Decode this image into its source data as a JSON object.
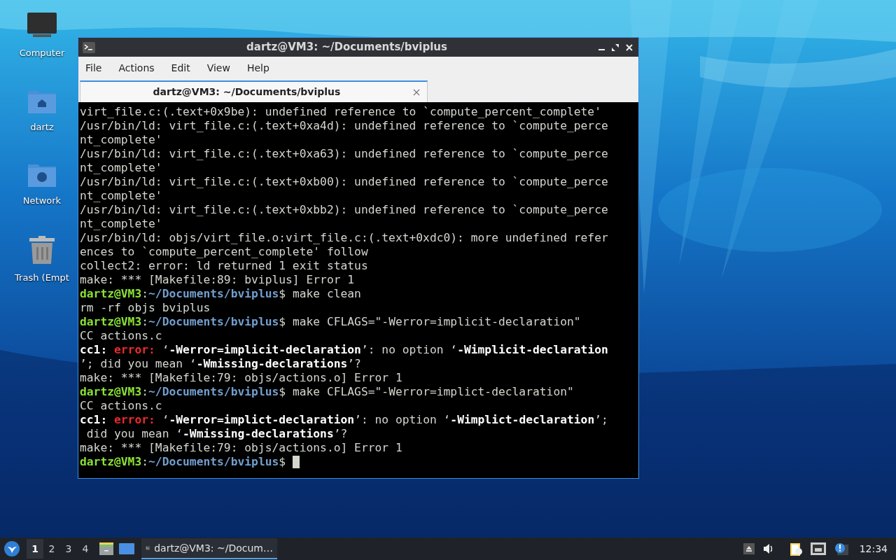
{
  "desktop_icons": [
    {
      "label": "Computer",
      "kind": "computer"
    },
    {
      "label": "dartz",
      "kind": "home"
    },
    {
      "label": "Network",
      "kind": "network"
    },
    {
      "label": "Trash (Empt",
      "kind": "trash"
    }
  ],
  "window": {
    "title": "dartz@VM3: ~/Documents/bviplus",
    "menu": [
      "File",
      "Actions",
      "Edit",
      "View",
      "Help"
    ],
    "tabs": [
      {
        "label": "dartz@VM3: ~/Documents/bviplus",
        "selected": true
      }
    ],
    "terminal": {
      "cursor": true,
      "lines": [
        [
          {
            "kind": "plain",
            "text": "virt_file.c:(.text+0x9be): undefined reference to `compute_percent_complete'"
          }
        ],
        [
          {
            "kind": "plain",
            "text": "/usr/bin/ld: virt_file.c:(.text+0xa4d): undefined reference to `compute_perce"
          }
        ],
        [
          {
            "kind": "plain",
            "text": "nt_complete'"
          }
        ],
        [
          {
            "kind": "plain",
            "text": "/usr/bin/ld: virt_file.c:(.text+0xa63): undefined reference to `compute_perce"
          }
        ],
        [
          {
            "kind": "plain",
            "text": "nt_complete'"
          }
        ],
        [
          {
            "kind": "plain",
            "text": "/usr/bin/ld: virt_file.c:(.text+0xb00): undefined reference to `compute_perce"
          }
        ],
        [
          {
            "kind": "plain",
            "text": "nt_complete'"
          }
        ],
        [
          {
            "kind": "plain",
            "text": "/usr/bin/ld: virt_file.c:(.text+0xbb2): undefined reference to `compute_perce"
          }
        ],
        [
          {
            "kind": "plain",
            "text": "nt_complete'"
          }
        ],
        [
          {
            "kind": "plain",
            "text": "/usr/bin/ld: objs/virt_file.o:virt_file.c:(.text+0xdc0): more undefined refer"
          }
        ],
        [
          {
            "kind": "plain",
            "text": "ences to `compute_percent_complete' follow"
          }
        ],
        [
          {
            "kind": "plain",
            "text": "collect2: error: ld returned 1 exit status"
          }
        ],
        [
          {
            "kind": "plain",
            "text": "make: *** [Makefile:89: bviplus] Error 1"
          }
        ],
        [
          {
            "kind": "user",
            "text": "dartz@VM3"
          },
          {
            "kind": "plain",
            "text": ":"
          },
          {
            "kind": "path",
            "text": "~/Documents/bviplus"
          },
          {
            "kind": "plain",
            "text": "$ make clean"
          }
        ],
        [
          {
            "kind": "plain",
            "text": "rm -rf objs bviplus"
          }
        ],
        [
          {
            "kind": "user",
            "text": "dartz@VM3"
          },
          {
            "kind": "plain",
            "text": ":"
          },
          {
            "kind": "path",
            "text": "~/Documents/bviplus"
          },
          {
            "kind": "plain",
            "text": "$ make CFLAGS=\"-Werror=implicit-declaration\""
          }
        ],
        [
          {
            "kind": "plain",
            "text": "CC actions.c"
          }
        ],
        [
          {
            "kind": "bold",
            "text": "cc1: "
          },
          {
            "kind": "error",
            "text": "error: "
          },
          {
            "kind": "plain",
            "text": "‘"
          },
          {
            "kind": "bold",
            "text": "-Werror=implicit-declaration"
          },
          {
            "kind": "plain",
            "text": "’: no option ‘"
          },
          {
            "kind": "bold",
            "text": "-Wimplicit-declaration"
          }
        ],
        [
          {
            "kind": "plain",
            "text": "’; did you mean ‘"
          },
          {
            "kind": "bold",
            "text": "-Wmissing-declarations"
          },
          {
            "kind": "plain",
            "text": "’?"
          }
        ],
        [
          {
            "kind": "plain",
            "text": "make: *** [Makefile:79: objs/actions.o] Error 1"
          }
        ],
        [
          {
            "kind": "user",
            "text": "dartz@VM3"
          },
          {
            "kind": "plain",
            "text": ":"
          },
          {
            "kind": "path",
            "text": "~/Documents/bviplus"
          },
          {
            "kind": "plain",
            "text": "$ make CFLAGS=\"-Werror=implict-declaration\""
          }
        ],
        [
          {
            "kind": "plain",
            "text": "CC actions.c"
          }
        ],
        [
          {
            "kind": "bold",
            "text": "cc1: "
          },
          {
            "kind": "error",
            "text": "error: "
          },
          {
            "kind": "plain",
            "text": "‘"
          },
          {
            "kind": "bold",
            "text": "-Werror=implict-declaration"
          },
          {
            "kind": "plain",
            "text": "’: no option ‘"
          },
          {
            "kind": "bold",
            "text": "-Wimplict-declaration"
          },
          {
            "kind": "plain",
            "text": "’;"
          }
        ],
        [
          {
            "kind": "plain",
            "text": " did you mean ‘"
          },
          {
            "kind": "bold",
            "text": "-Wmissing-declarations"
          },
          {
            "kind": "plain",
            "text": "’?"
          }
        ],
        [
          {
            "kind": "plain",
            "text": "make: *** [Makefile:79: objs/actions.o] Error 1"
          }
        ],
        [
          {
            "kind": "user",
            "text": "dartz@VM3"
          },
          {
            "kind": "plain",
            "text": ":"
          },
          {
            "kind": "path",
            "text": "~/Documents/bviplus"
          },
          {
            "kind": "plain",
            "text": "$ "
          }
        ]
      ]
    }
  },
  "taskbar": {
    "workspaces": [
      {
        "label": "1",
        "selected": true
      },
      {
        "label": "2",
        "selected": false
      },
      {
        "label": "3",
        "selected": false
      },
      {
        "label": "4",
        "selected": false
      }
    ],
    "tasks": [
      {
        "label": "dartz@VM3: ~/Docum…",
        "selected": true
      }
    ],
    "clock": "12:34"
  }
}
